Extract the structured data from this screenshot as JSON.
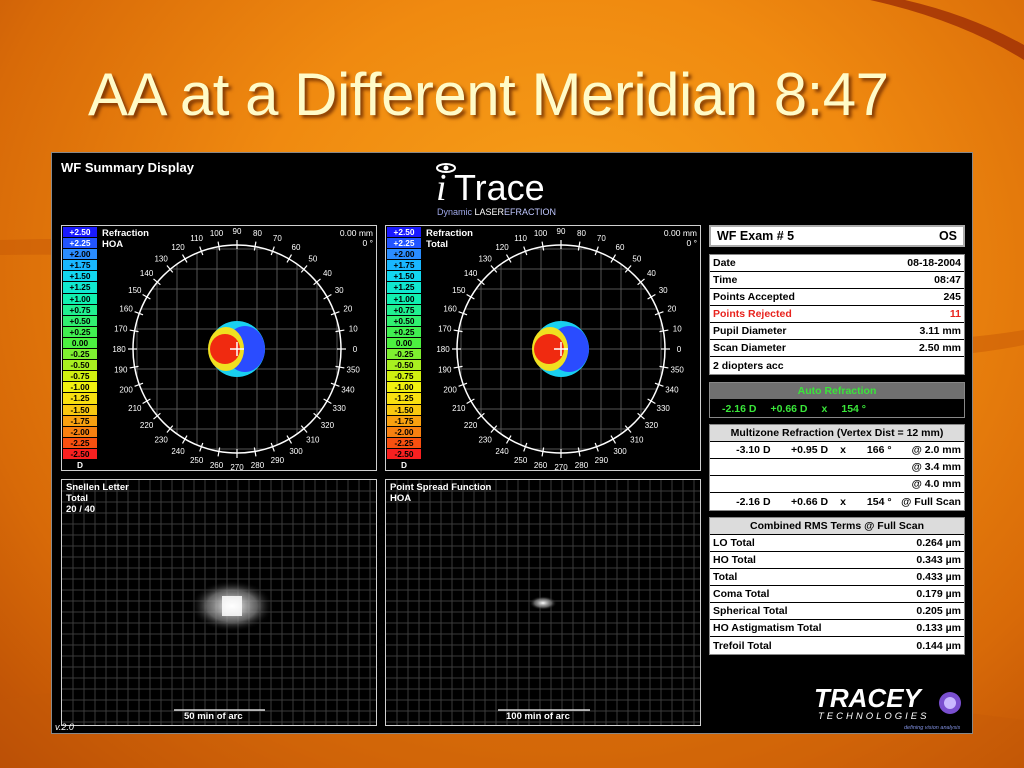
{
  "slide": {
    "title": "AA at a Different Meridian 8:47"
  },
  "screen": {
    "title": "WF Summary Display",
    "version": "v.2.0",
    "brand": {
      "name": "Trace",
      "tagline_a": "Dynamic ",
      "tagline_b": "LASER",
      "tagline_c": "EFRACTION"
    },
    "maps": [
      {
        "label1": "Refraction",
        "label2": "HOA",
        "mm": "0.00 mm",
        "deg": "0 °"
      },
      {
        "label1": "Refraction",
        "label2": "Total",
        "mm": "0.00 mm",
        "deg": "0 °"
      }
    ],
    "scale": {
      "values": [
        "+2.50",
        "+2.25",
        "+2.00",
        "+1.75",
        "+1.50",
        "+1.25",
        "+1.00",
        "+0.75",
        "+0.50",
        "+0.25",
        "0.00",
        "-0.25",
        "-0.50",
        "-0.75",
        "-1.00",
        "-1.25",
        "-1.50",
        "-1.75",
        "-2.00",
        "-2.25",
        "-2.50"
      ],
      "colors": [
        "#1a1aff",
        "#2255ff",
        "#2a8cff",
        "#19b7ff",
        "#12d7f0",
        "#10e8d0",
        "#10f0b0",
        "#20f090",
        "#30f070",
        "#40f050",
        "#4cf040",
        "#7ef030",
        "#a8f020",
        "#d0f010",
        "#f0f010",
        "#f8e010",
        "#f8c810",
        "#f8a010",
        "#f88010",
        "#f85010",
        "#f82020"
      ],
      "unit": "D"
    },
    "angles": [
      "0",
      "10",
      "20",
      "30",
      "40",
      "50",
      "60",
      "70",
      "80",
      "90",
      "100",
      "110",
      "120",
      "130",
      "140",
      "150",
      "160",
      "170",
      "180",
      "190",
      "200",
      "210",
      "220",
      "230",
      "240",
      "250",
      "260",
      "270",
      "280",
      "290",
      "300",
      "310",
      "320",
      "330",
      "340",
      "350"
    ],
    "snellen": {
      "label1": "Snellen Letter",
      "label2": "Total",
      "label3": "20 / 40",
      "scale": "50 min of arc"
    },
    "psf": {
      "label1": "Point Spread Function",
      "label2": "HOA",
      "scale": "100 min of arc"
    },
    "exam": {
      "title": "WF Exam  # 5",
      "eye": "OS"
    },
    "info": [
      {
        "k": "Date",
        "v": "08-18-2004"
      },
      {
        "k": "Time",
        "v": "08:47"
      },
      {
        "k": "Points Accepted",
        "v": "245"
      },
      {
        "k": "Points Rejected",
        "v": "11"
      },
      {
        "k": "Pupil Diameter",
        "v": "3.11 mm"
      },
      {
        "k": "Scan Diameter",
        "v": "2.50 mm"
      },
      {
        "k": "2 diopters acc",
        "v": ""
      }
    ],
    "auto": {
      "title": "Auto Refraction",
      "sph": "-2.16 D",
      "cyl": "+0.66 D",
      "x": "x",
      "axis": "154 °"
    },
    "multizone": {
      "title": "Multizone Refraction  (Vertex Dist = 12 mm)",
      "rows": [
        {
          "sph": "-3.10 D",
          "cyl": "+0.95 D",
          "x": "x",
          "axis": "166 °",
          "zone": "@ 2.0 mm"
        },
        {
          "sph": "",
          "cyl": "",
          "x": "",
          "axis": "",
          "zone": "@ 3.4 mm"
        },
        {
          "sph": "",
          "cyl": "",
          "x": "",
          "axis": "",
          "zone": "@ 4.0 mm"
        },
        {
          "sph": "-2.16 D",
          "cyl": "+0.66 D",
          "x": "x",
          "axis": "154 °",
          "zone": "@ Full Scan"
        }
      ]
    },
    "rms": {
      "title": "Combined RMS Terms @ Full Scan",
      "rows": [
        {
          "k": "LO Total",
          "v": "0.264 µm"
        },
        {
          "k": "HO Total",
          "v": "0.343 µm"
        },
        {
          "k": "Total",
          "v": "0.433 µm"
        },
        {
          "k": "Coma Total",
          "v": "0.179 µm"
        },
        {
          "k": "Spherical Total",
          "v": "0.205 µm"
        },
        {
          "k": "HO Astigmatism Total",
          "v": "0.133 µm"
        },
        {
          "k": "Trefoil Total",
          "v": "0.144 µm"
        }
      ]
    },
    "tracey": {
      "name": "TRACEY",
      "sub": "TECHNOLOGIES",
      "tag": "defining vision analysis"
    }
  }
}
